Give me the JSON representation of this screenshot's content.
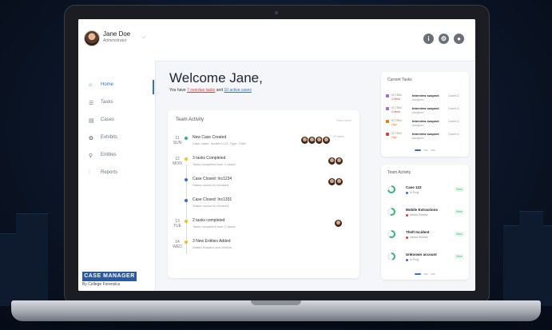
{
  "colors": {
    "accent": "#2f6fd6",
    "danger": "#e53935",
    "success": "#2eb872",
    "brand": "#2c5aa0"
  },
  "header": {
    "user_name": "Jane Doe",
    "user_role": "Administrator",
    "icons": [
      "info-icon",
      "gear-icon",
      "notification-icon"
    ]
  },
  "sidebar": {
    "items": [
      {
        "label": "Home",
        "icon": "home-icon"
      },
      {
        "label": "Tasks",
        "icon": "tasks-icon"
      },
      {
        "label": "Cases",
        "icon": "cases-icon"
      },
      {
        "label": "Exhibits",
        "icon": "exhibits-icon"
      },
      {
        "label": "Entities",
        "icon": "entities-icon"
      },
      {
        "label": "Reports",
        "icon": "reports-icon"
      }
    ],
    "brand": "CASE MANAGER",
    "brand_sub": "By Cellege Forensics"
  },
  "main": {
    "welcome": "Welcome Jane,",
    "summary_prefix": "You have ",
    "overdue": "7 overdue tasks",
    "summary_mid": " and ",
    "active": "10 active cases"
  },
  "team_activity": {
    "title": "Team Activity",
    "link": "View more",
    "items": [
      {
        "day": "11",
        "dow": "SUN",
        "title": "New Case Created",
        "sub": "Case name: Incident 123, Type: Theft",
        "dot": "#2eb872"
      },
      {
        "day": "12",
        "dow": "MON",
        "title": "3 tasks Completed",
        "sub": "Tasks completed over 2 cases",
        "dot": "#f4c20d"
      },
      {
        "day": "",
        "dow": "",
        "title": "Case Closed: Inc1234",
        "sub": "Status moved to resolved",
        "dot": "#2f6fd6"
      },
      {
        "day": "",
        "dow": "",
        "title": "Case Closed: Inc1331",
        "sub": "Status moved to resolved",
        "dot": "#2f6fd6"
      },
      {
        "day": "13",
        "dow": "TUE",
        "title": "2 tasks completed",
        "sub": "Tasks completed over 2 cases",
        "dot": "#f4c20d"
      },
      {
        "day": "14",
        "dow": "WED",
        "title": "3 New Entities Added",
        "sub": "Added Suspect and Vehicle",
        "dot": "#f4c20d"
      }
    ],
    "more_count": "+3 more"
  },
  "current_tasks": {
    "title": "Current Tasks",
    "items": [
      {
        "num": "SC7894",
        "pri": "Critical",
        "pri_color": "#e53935",
        "tag": "#9c6ade",
        "name": "Interview suspect",
        "status": "Assigned",
        "type": "Case#12"
      },
      {
        "num": "SC7894",
        "pri": "Critical",
        "pri_color": "#e53935",
        "tag": "#9c6ade",
        "name": "Interview suspect",
        "status": "Assigned",
        "type": "Case#12"
      },
      {
        "num": "SC7894",
        "pri": "High",
        "pri_color": "#f57c00",
        "tag": "#f57c00",
        "name": "Interview suspect",
        "status": "Assigned",
        "type": "Case#12"
      },
      {
        "num": "SC7894",
        "pri": "High",
        "pri_color": "#f57c00",
        "tag": "#e53935",
        "name": "Interview suspect",
        "status": "Assigned",
        "type": "Case#12"
      }
    ]
  },
  "team_activity2": {
    "title": "Team Activity",
    "items": [
      {
        "name": "Case 123",
        "status": "In Prog",
        "status_color": "#2f6fd6",
        "progress": 0.72,
        "action": "View"
      },
      {
        "name": "Mobile Extractions",
        "status": "Needs Review",
        "status_color": "#e53935",
        "progress": 0.55,
        "action": "View"
      },
      {
        "name": "Theft Incident",
        "status": "Needs Review",
        "status_color": "#e53935",
        "progress": 0.6,
        "action": "View"
      },
      {
        "name": "Unknown account",
        "status": "In Prog",
        "status_color": "#2f6fd6",
        "progress": 0.45,
        "action": "View"
      }
    ]
  }
}
